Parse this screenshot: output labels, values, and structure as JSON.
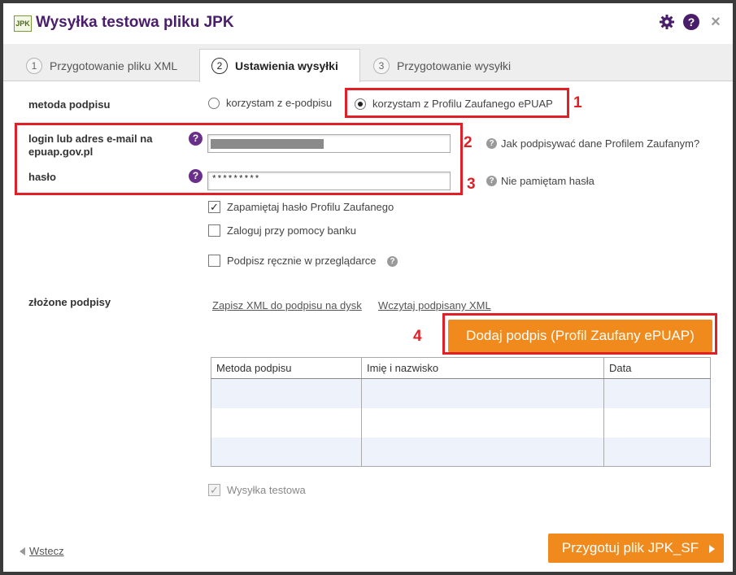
{
  "window": {
    "logo_text": "JPK",
    "title": "Wysyłka testowa pliku JPK",
    "help_glyph": "?",
    "close_glyph": "×"
  },
  "tabs": [
    {
      "num": "1",
      "label": "Przygotowanie pliku XML",
      "active": false
    },
    {
      "num": "2",
      "label": "Ustawienia wysyłki",
      "active": true
    },
    {
      "num": "3",
      "label": "Przygotowanie wysyłki",
      "active": false
    }
  ],
  "signature_method": {
    "label": "metoda podpisu",
    "options": [
      {
        "label": "korzystam z e-podpisu",
        "selected": false
      },
      {
        "label": "korzystam z Profilu Zaufanego ePUAP",
        "selected": true
      }
    ]
  },
  "login": {
    "label_line1": "login lub adres e-mail na",
    "label_line2": "epuap.gov.pl",
    "value": "",
    "hint": "Jak podpisywać dane Profilem Zaufanym?"
  },
  "password": {
    "label": "hasło",
    "value": "*********",
    "hint": "Nie pamiętam hasła"
  },
  "checkboxes": [
    {
      "label": "Zapamiętaj hasło Profilu Zaufanego",
      "checked": true
    },
    {
      "label": "Zaloguj przy pomocy banku",
      "checked": false
    },
    {
      "label": "Podpisz ręcznie w przeglądarce",
      "checked": false
    }
  ],
  "signatures": {
    "label": "złożone podpisy",
    "link_save": "Zapisz XML do podpisu na dysk",
    "link_load": "Wczytaj podpisany XML",
    "add_button": "Dodaj podpis (Profil Zaufany ePUAP)",
    "columns": [
      "Metoda podpisu",
      "Imię i nazwisko",
      "Data"
    ],
    "rows": [
      [
        "",
        "",
        ""
      ],
      [
        "",
        "",
        ""
      ],
      [
        "",
        "",
        ""
      ]
    ]
  },
  "test_send": {
    "label": "Wysyłka testowa",
    "checked": true,
    "disabled": true
  },
  "footer": {
    "back_label": "Wstecz",
    "next_label": "Przygotuj plik JPK_SF"
  },
  "annotations": [
    "1",
    "2",
    "3",
    "4"
  ],
  "colors": {
    "title": "#4a1d6b",
    "accent_orange": "#f08a1c",
    "annotation_red": "#e01f26",
    "help_purple": "#6a2f8a"
  }
}
